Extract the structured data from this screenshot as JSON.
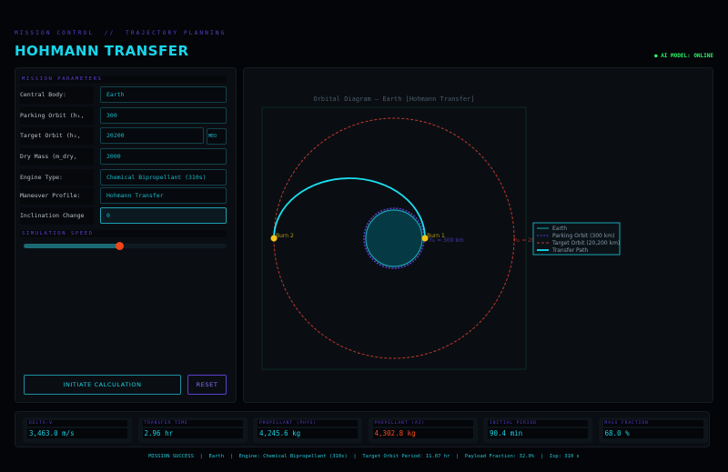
{
  "header": {
    "breadcrumb": "MISSION CONTROL  //  TRAJECTORY PLANNING",
    "title": "HOHMANN TRANSFER",
    "status": "● AI MODEL: ONLINE"
  },
  "params": {
    "section_title": "MISSION PARAMETERS",
    "fields": [
      {
        "label": "Central Body:",
        "value": "Earth"
      },
      {
        "label": "Parking Orbit (h₁, km):",
        "value": "300"
      },
      {
        "label": "Target Orbit (h₂, km):",
        "value": "20200",
        "badge": "MEO"
      },
      {
        "label": "Dry Mass (m_dry, kg):",
        "value": "2000"
      },
      {
        "label": "Engine Type:",
        "value": "Chemical Bipropellant (310s)"
      },
      {
        "label": "Maneuver Profile:",
        "value": "Hohmann Transfer"
      },
      {
        "label": "Inclination Change (°):",
        "value": "0"
      }
    ],
    "speed_title": "SIMULATION SPEED",
    "speed_fraction": 0.47,
    "calc_button": "INITIATE CALCULATION",
    "reset_button": "RESET"
  },
  "diagram": {
    "title": "Orbital Diagram — Earth  [Hohmann Transfer]",
    "burn1": "Burn 1",
    "burn2": "Burn 2",
    "h1_label": "h₁ = 300 km",
    "h2_label": "h₂ = 20",
    "legend": [
      "Earth",
      "Parking Orbit (300 km)",
      "Target Orbit (20,200 km)",
      "Transfer Path"
    ],
    "colors": {
      "earth": "#1aa5b5",
      "parking": "#5b3fd0",
      "target": "#c0392b",
      "transfer": "#19e0f0",
      "burn": "#f5c518"
    }
  },
  "stats": [
    {
      "label": "DELTA-V",
      "value": "3,463.0 m/s"
    },
    {
      "label": "TRANSFER TIME",
      "value": "2.96 hr"
    },
    {
      "label": "PROPELLANT (PHYS)",
      "value": "4,245.6 kg"
    },
    {
      "label": "PROPELLANT (AI)",
      "value": "4,302.8 kg",
      "color": "#ff4a1a"
    },
    {
      "label": "INITIAL PERIOD",
      "value": "90.4 min"
    },
    {
      "label": "MASS FRACTION",
      "value": "68.0 %"
    }
  ],
  "footer": "MISSION SUCCESS  |  Earth  |  Engine: Chemical Bipropellant (310s)  |  Target Orbit Period: 11.07 hr  |  Payload Fraction: 32.0%  |  Isp: 310 s"
}
